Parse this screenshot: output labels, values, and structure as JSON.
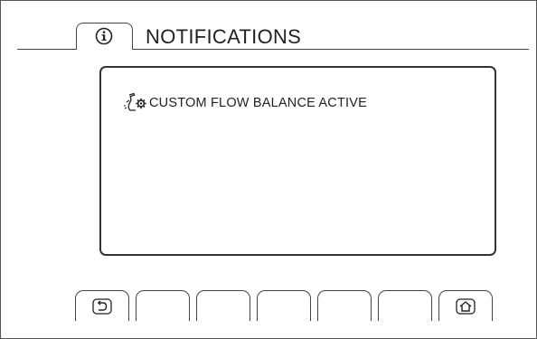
{
  "header": {
    "title": "NOTIFICATIONS",
    "tab_icon": "info-icon"
  },
  "notifications": [
    {
      "icon": "custom-flow-balance-icon",
      "text": "CUSTOM FLOW BALANCE ACTIVE"
    }
  ],
  "softkeys": [
    {
      "icon": "back-icon",
      "label": ""
    },
    {
      "icon": "",
      "label": ""
    },
    {
      "icon": "",
      "label": ""
    },
    {
      "icon": "",
      "label": ""
    },
    {
      "icon": "",
      "label": ""
    },
    {
      "icon": "",
      "label": ""
    },
    {
      "icon": "home-icon",
      "label": ""
    }
  ],
  "colors": {
    "foreground": "#222222",
    "background": "#ffffff"
  }
}
